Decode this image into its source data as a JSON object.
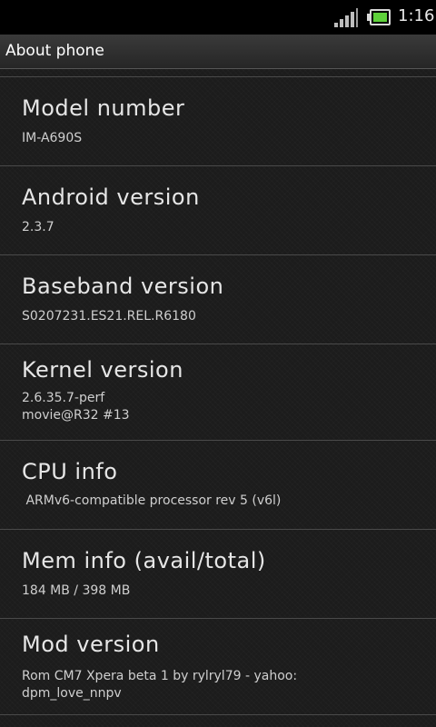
{
  "status_bar": {
    "time": "1:16",
    "signal_icon": "signal-bars-icon",
    "battery_icon": "battery-icon",
    "battery_color": "#5ed13a"
  },
  "title_bar": {
    "title": "About phone"
  },
  "items": [
    {
      "title": "Model number",
      "summary": [
        "IM-A690S"
      ]
    },
    {
      "title": "Android version",
      "summary": [
        "2.3.7"
      ]
    },
    {
      "title": "Baseband version",
      "summary": [
        "S0207231.ES21.REL.R6180"
      ]
    },
    {
      "title": "Kernel version",
      "summary": [
        "2.6.35.7-perf",
        "movie@R32 #13"
      ]
    },
    {
      "title": "CPU info",
      "summary": [
        " ARMv6-compatible processor rev 5 (v6l)"
      ]
    },
    {
      "title": "Mem info (avail/total)",
      "summary": [
        "184 MB / 398 MB"
      ]
    },
    {
      "title": "Mod version",
      "summary": [
        "Rom CM7 Xpera beta 1 by rylryl79 - yahoo:",
        "dpm_love_nnpv"
      ]
    }
  ]
}
